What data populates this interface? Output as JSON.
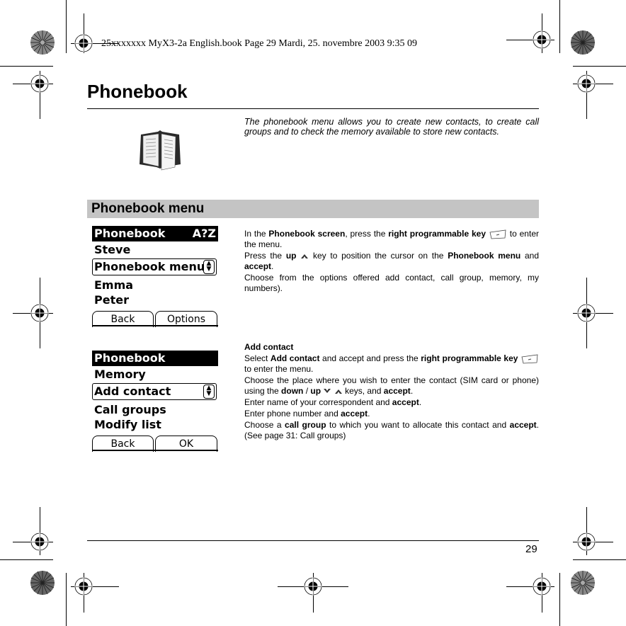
{
  "print_header": "25xxxxxxx MyX3-2a English.book  Page 29  Mardi, 25. novembre 2003  9:35 09",
  "page": {
    "title": "Phonebook",
    "intro": "The phonebook menu allows you to create new contacts, to create call groups and to check the memory available to store new contacts.",
    "section_title": "Phonebook menu",
    "page_number": "29"
  },
  "icons": {
    "book": "phonebook-book-icon",
    "softkey": "right-programmable-key-icon",
    "up": "up-key-icon",
    "down": "down-key-icon"
  },
  "block1": {
    "p1": {
      "t1": "In the ",
      "b1": "Phonebook screen",
      "t2": ", press the ",
      "b2": "right programmable key",
      "t3": " to enter the menu."
    },
    "p2": {
      "t1": "Press the ",
      "b1": "up",
      "t2": " key to position the cursor on the ",
      "b2": "Phonebook menu",
      "t3": " and ",
      "b3": "accept",
      "t4": "."
    },
    "p3": "Choose from the options offered add contact, call group, memory, my numbers)."
  },
  "screen1": {
    "header_left": "Phonebook",
    "header_right": "A?Z",
    "rows": [
      "Steve",
      "Phonebook menu",
      "Emma",
      "Peter"
    ],
    "selected_index": 1,
    "softkey_left": "Back",
    "softkey_right": "Options"
  },
  "block2": {
    "heading": "Add contact",
    "p1": {
      "t1": "Select ",
      "b1": "Add contact",
      "t2": " and accept and press the ",
      "b2": "right programmable key",
      "t3": " to enter the menu."
    },
    "p2": {
      "t1": "Choose the place where you wish to enter the contact (SIM card or phone) using the ",
      "b1": "down",
      "t2": " / ",
      "b2": "up",
      "t3": " keys, and ",
      "b3": "accept",
      "t4": "."
    },
    "p3": {
      "t1": "Enter name of your correspondent and ",
      "b1": "accept",
      "t2": "."
    },
    "p4": {
      "t1": "Enter phone number and ",
      "b1": "accept",
      "t2": "."
    },
    "p5": {
      "t1": "Choose a ",
      "b1": "call group",
      "t2": " to which you want to allocate this contact and ",
      "b2": "accept",
      "t3": ". (See page 31: Call groups)"
    }
  },
  "screen2": {
    "header_left": "Phonebook",
    "rows": [
      "Memory",
      "Add contact",
      "Call groups",
      "Modify list"
    ],
    "selected_index": 1,
    "softkey_left": "Back",
    "softkey_right": "OK"
  },
  "scroll_arrows": "▲▼"
}
